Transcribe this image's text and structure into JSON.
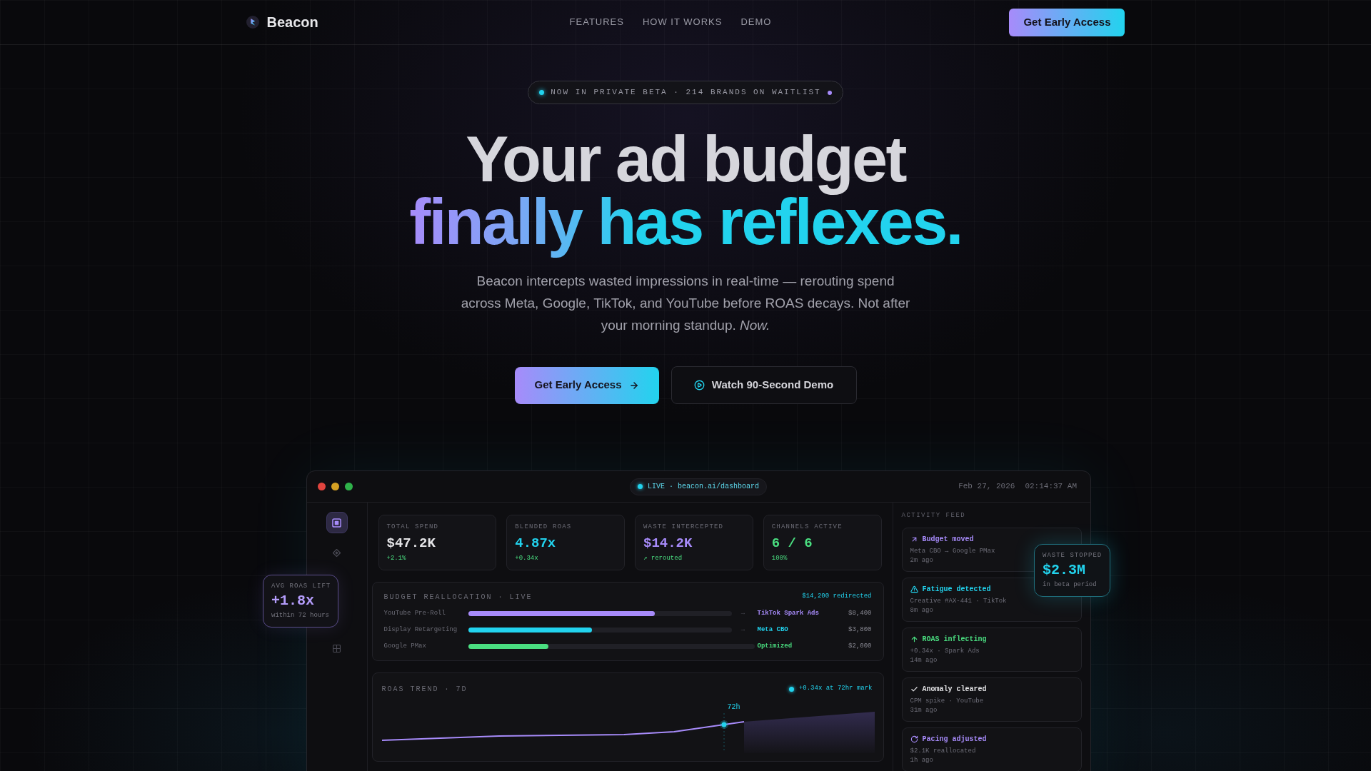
{
  "nav": {
    "brand": "Beacon",
    "links": [
      "FEATURES",
      "HOW IT WORKS",
      "DEMO"
    ],
    "cta": "Get Early Access"
  },
  "beta_badge": "NOW IN PRIVATE BETA · 214 BRANDS ON WAITLIST",
  "hero": {
    "headline": "Your ad budget",
    "headline_highlight": "finally has reflexes.",
    "subtitle": "Beacon intercepts wasted impressions in real-time — rerouting spend across Meta, Google, TikTok, and YouTube before ROAS decays. Not after your morning standup. *Now.*",
    "primary_button": "Get Early Access",
    "secondary_button": "Watch 90-Second Demo"
  },
  "dashboard": {
    "live_badge": "LIVE · beacon.ai/dashboard",
    "date": "Feb 27, 2026",
    "time": "02:14:37 AM",
    "sidebar": [
      {
        "kind": "square",
        "selected": true
      },
      {
        "kind": "diamond",
        "selected": false
      },
      {
        "kind": "grid",
        "selected": false
      }
    ],
    "kpis": [
      {
        "label": "TOTAL SPEND",
        "value": "$47.2K",
        "delta": "+2.1%",
        "color": "#e4e4e7"
      },
      {
        "label": "BLENDED ROAS",
        "value": "4.87x",
        "delta": "+0.34x",
        "color": "#22d3ee"
      },
      {
        "label": "WASTE INTERCEPTED",
        "value": "$14.2K",
        "delta": "↗ rerouted",
        "color": "#a78bfa"
      },
      {
        "label": "CHANNELS ACTIVE",
        "value": "6 / 6",
        "delta": "100%",
        "color": "#4ade80"
      }
    ],
    "budget_reallocation": {
      "title": "BUDGET REALLOCATION · LIVE",
      "total": "$14,200 redirected",
      "rows": [
        {
          "source": "YouTube Pre-Roll",
          "level": 0.71,
          "arrow": "→",
          "target": "TikTok Spark Ads",
          "amount": "$8,400",
          "color": "#a78bfa"
        },
        {
          "source": "Display Retargeting",
          "level": 0.47,
          "arrow": "→",
          "target": "Meta CBO",
          "amount": "$3,800",
          "color": "#22d3ee"
        },
        {
          "source": "Google PMax",
          "level": 0.28,
          "target": "Optimized",
          "amount": "$2,000",
          "color": "#4ade80"
        }
      ]
    },
    "roas_trend": {
      "title": "ROAS TREND · 7D",
      "legend": "+0.34x at 72hr mark",
      "marker_label": "72h"
    },
    "activity_feed": {
      "title": "ACTIVITY FEED",
      "items": [
        {
          "kind": "moved",
          "title": "Budget moved",
          "detail": "Meta CBO → Google PMax",
          "time": "2m ago",
          "color": "#a78bfa"
        },
        {
          "kind": "warning",
          "title": "Fatigue detected",
          "detail": "Creative #AX-441 · TikTok",
          "time": "8m ago",
          "color": "#22d3ee"
        },
        {
          "kind": "rising",
          "title": "ROAS inflecting",
          "detail": "+0.34x · Spark Ads",
          "time": "14m ago",
          "color": "#4ade80"
        },
        {
          "kind": "cleared",
          "title": "Anomaly cleared",
          "detail": "CPM spike · YouTube",
          "time": "31m ago",
          "color": "#e4e4e7"
        },
        {
          "kind": "pacing",
          "title": "Pacing adjusted",
          "detail": "$2.1K reallocated",
          "time": "1h ago",
          "color": "#a78bfa"
        }
      ]
    }
  },
  "roas_lift_card": {
    "label": "AVG ROAS LIFT",
    "value": "+1.8x",
    "caption": "within 72 hours"
  },
  "waste_card": {
    "label": "WASTE STOPPED",
    "value": "$2.3M",
    "caption": "in beta period"
  }
}
